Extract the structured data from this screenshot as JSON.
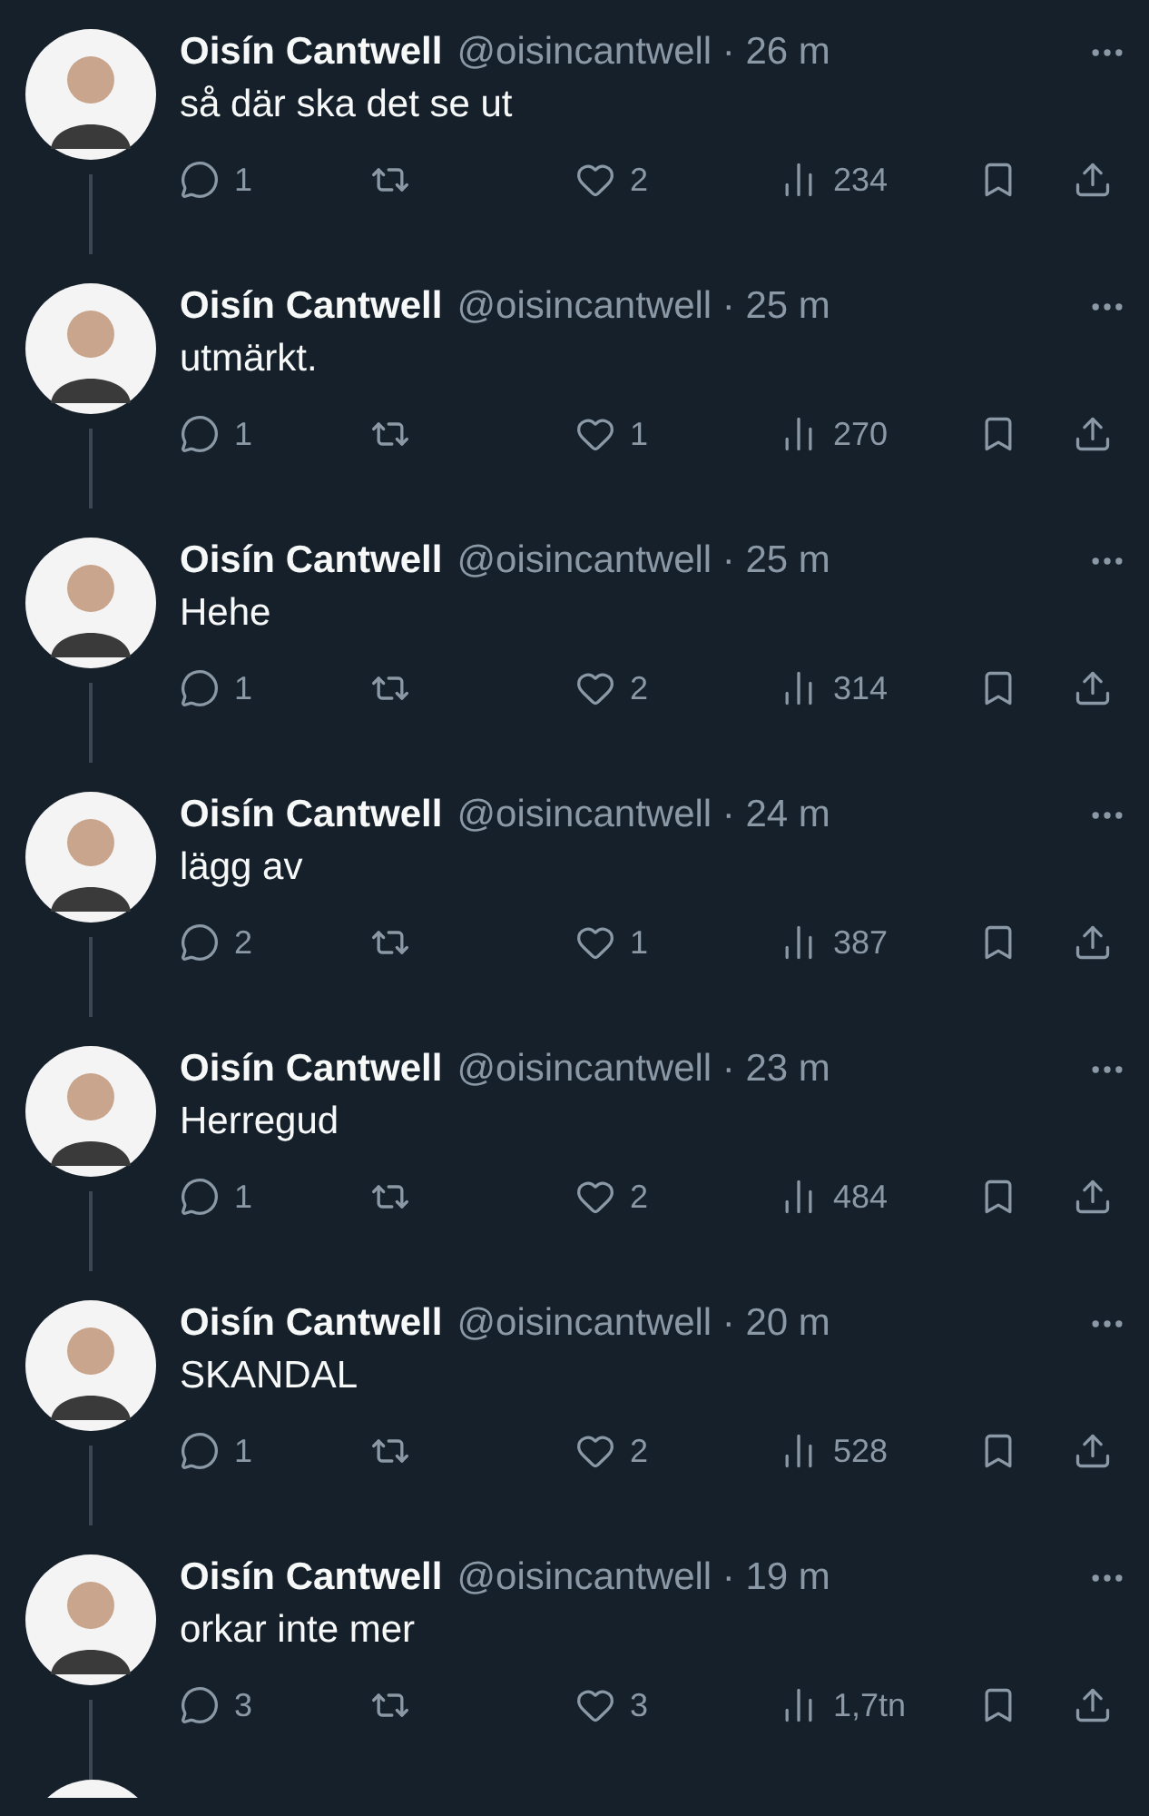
{
  "tweets": [
    {
      "name": "Oisín Cantwell",
      "meta": "@oisincantwell · 26 m",
      "text": "så där ska det se ut",
      "replies": "1",
      "likes": "2",
      "views": "234"
    },
    {
      "name": "Oisín Cantwell",
      "meta": "@oisincantwell · 25 m",
      "text": "utmärkt.",
      "replies": "1",
      "likes": "1",
      "views": "270"
    },
    {
      "name": "Oisín Cantwell",
      "meta": "@oisincantwell · 25 m",
      "text": "Hehe",
      "replies": "1",
      "likes": "2",
      "views": "314"
    },
    {
      "name": "Oisín Cantwell",
      "meta": "@oisincantwell · 24 m",
      "text": "lägg av",
      "replies": "2",
      "likes": "1",
      "views": "387"
    },
    {
      "name": "Oisín Cantwell",
      "meta": "@oisincantwell · 23 m",
      "text": "Herregud",
      "replies": "1",
      "likes": "2",
      "views": "484"
    },
    {
      "name": "Oisín Cantwell",
      "meta": "@oisincantwell · 20 m",
      "text": "SKANDAL",
      "replies": "1",
      "likes": "2",
      "views": "528"
    },
    {
      "name": "Oisín Cantwell",
      "meta": "@oisincantwell · 19 m",
      "text": "orkar inte mer",
      "replies": "3",
      "likes": "3",
      "views": "1,7tn"
    }
  ]
}
